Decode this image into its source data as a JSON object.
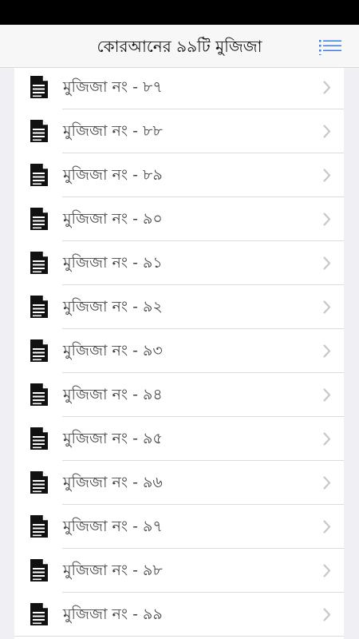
{
  "header": {
    "title": "কোরআনের ৯৯টি মুজিজা",
    "menu_icon": "menu-list-icon"
  },
  "colors": {
    "status_bar": "#000000",
    "nav_background": "#f7f7f7",
    "accent": "#3b7ddd",
    "list_background": "#ffffff",
    "page_background": "#efeff4",
    "label_text": "#444444",
    "chevron": "#c7c7cc"
  },
  "list": {
    "item_icon": "document-icon",
    "disclosure_icon": "chevron-right-icon",
    "items": [
      {
        "label": "মুজিজা নং - ৮৭"
      },
      {
        "label": "মুজিজা নং - ৮৮"
      },
      {
        "label": "মুজিজা নং - ৮৯"
      },
      {
        "label": "মুজিজা নং - ৯০"
      },
      {
        "label": "মুজিজা নং - ৯১"
      },
      {
        "label": "মুজিজা নং - ৯২"
      },
      {
        "label": "মুজিজা নং - ৯৩"
      },
      {
        "label": "মুজিজা নং - ৯৪"
      },
      {
        "label": "মুজিজা নং - ৯৫"
      },
      {
        "label": "মুজিজা নং - ৯৬"
      },
      {
        "label": "মুজিজা নং - ৯৭"
      },
      {
        "label": "মুজিজা নং - ৯৮"
      },
      {
        "label": "মুজিজা নং - ৯৯"
      }
    ]
  }
}
